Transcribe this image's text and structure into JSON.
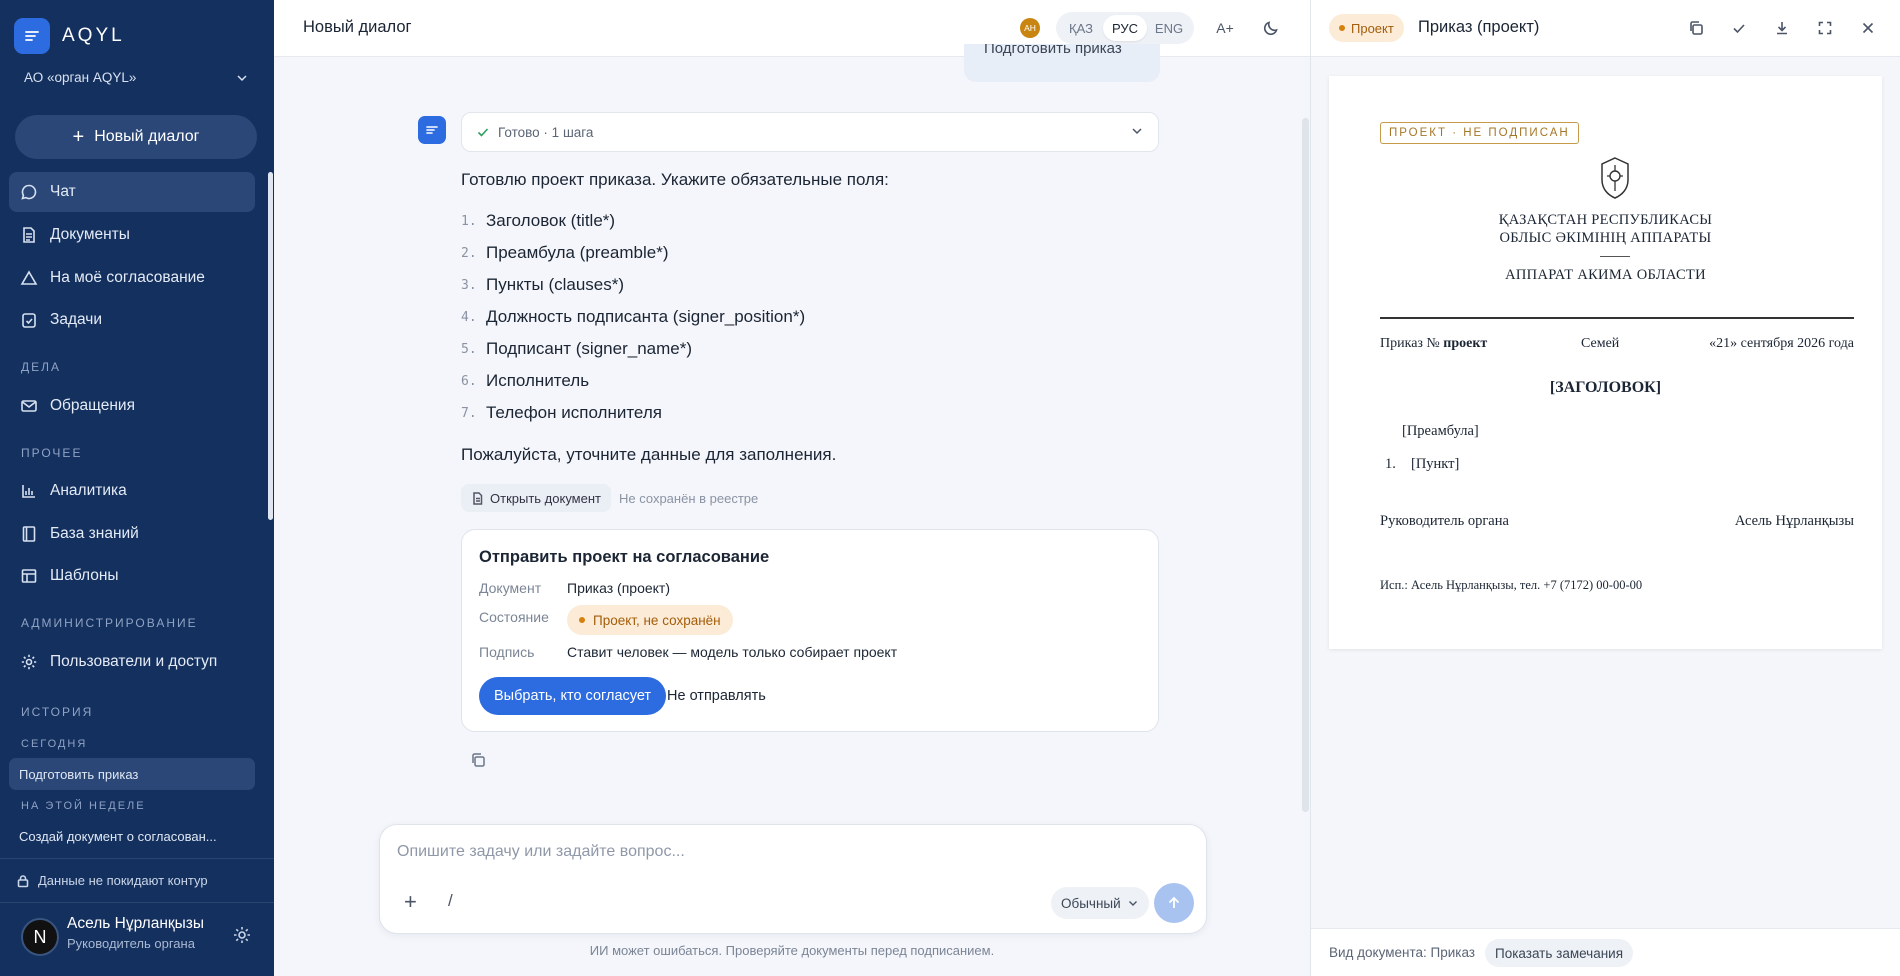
{
  "app": {
    "brand": "AQYL",
    "org": "АО «орган AQYL»"
  },
  "sidebar": {
    "new_chat": "Новый диалог",
    "items": [
      {
        "label": "Чат",
        "icon": "chat-icon"
      },
      {
        "label": "Документы",
        "icon": "document-icon"
      },
      {
        "label": "На моё согласование",
        "icon": "approval-icon"
      },
      {
        "label": "Задачи",
        "icon": "tasks-icon"
      }
    ],
    "section_affairs": "ДЕЛА",
    "affairs_items": [
      {
        "label": "Обращения",
        "icon": "mail-icon"
      }
    ],
    "section_other": "ПРОЧЕЕ",
    "other_items": [
      {
        "label": "Аналитика",
        "icon": "analytics-icon"
      },
      {
        "label": "База знаний",
        "icon": "book-icon"
      },
      {
        "label": "Шаблоны",
        "icon": "templates-icon"
      }
    ],
    "section_admin": "АДМИНИСТРИРОВАНИЕ",
    "admin_items": [
      {
        "label": "Пользователи и доступ",
        "icon": "gear-icon"
      }
    ],
    "section_history": "ИСТОРИЯ",
    "section_today": "СЕГОДНЯ",
    "today_items": [
      "Подготовить приказ"
    ],
    "section_week": "НА ЭТОЙ НЕДЕЛЕ",
    "week_items": [
      "Создай документ о согласован..."
    ],
    "privacy_note": "Данные не покидают контур",
    "user": {
      "initial": "N",
      "name": "Асель Нұрланқызы",
      "role": "Руководитель органа"
    }
  },
  "header": {
    "title": "Новый диалог",
    "avatar_initials": "АН",
    "languages": [
      "ҚАЗ",
      "РУС",
      "ENG"
    ],
    "active_language": "РУС",
    "font_size_label": "A+"
  },
  "chat": {
    "prev_user_message": "Подготовить приказ",
    "status": "Готово · 1 шага",
    "intro": "Готовлю проект приказа. Укажите обязательные поля:",
    "fields": [
      {
        "num": "1.",
        "text": "Заголовок (title*)"
      },
      {
        "num": "2.",
        "text": "Преамбула (preamble*)"
      },
      {
        "num": "3.",
        "text": "Пункты (clauses*)"
      },
      {
        "num": "4.",
        "text": "Должность подписанта (signer_position*)"
      },
      {
        "num": "5.",
        "text": "Подписант (signer_name*)"
      },
      {
        "num": "6.",
        "text": "Исполнитель"
      },
      {
        "num": "7.",
        "text": "Телефон исполнителя"
      }
    ],
    "outro": "Пожалуйста, уточните данные для заполнения.",
    "open_doc": "Открыть документ",
    "not_saved": "Не сохранён в реестре",
    "card": {
      "title": "Отправить проект на согласование",
      "doc_label": "Документ",
      "doc_value": "Приказ (проект)",
      "state_label": "Состояние",
      "state_value": "Проект, не сохранён",
      "sign_label": "Подпись",
      "sign_value": "Ставит человек — модель только собирает проект",
      "primary_btn": "Выбрать, кто согласует",
      "secondary_btn": "Не отправлять"
    }
  },
  "composer": {
    "placeholder": "Опишите задачу или задайте вопрос...",
    "slash": "/",
    "mode": "Обычный",
    "disclaimer": "ИИ может ошибаться. Проверяйте документы перед подписанием."
  },
  "panel": {
    "badge": "Проект",
    "title": "Приказ (проект)",
    "doc": {
      "stamp": "ПРОЕКТ · НЕ ПОДПИСАН",
      "kz_line1": "ҚАЗАҚСТАН РЕСПУБЛИКАСЫ",
      "kz_line2": "ОБЛЫС ӘКІМІНІҢ АППАРАТЫ",
      "ru_line": "АППАРАТ АКИМА ОБЛАСТИ",
      "order_prefix": "Приказ № ",
      "order_number": "проект",
      "city": "Семей",
      "date": "«21» сентября 2026 года",
      "heading": "[ЗАГОЛОВОК]",
      "preamble": "[Преамбула]",
      "clause_num": "1.",
      "clause": "[Пункт]",
      "signer_position": "Руководитель органа",
      "signer_name": "Асель Нұрланқызы",
      "executor": "Исп.: Асель Нұрланқызы, тел. +7 (7172) 00-00-00"
    },
    "footer_label": "Вид документа: Приказ",
    "footer_btn": "Показать замечания"
  },
  "colors": {
    "sidebar": "#14305e",
    "accent": "#2d6be0",
    "warning_bg": "#fcebd7",
    "warning_text": "#a45d0a"
  }
}
